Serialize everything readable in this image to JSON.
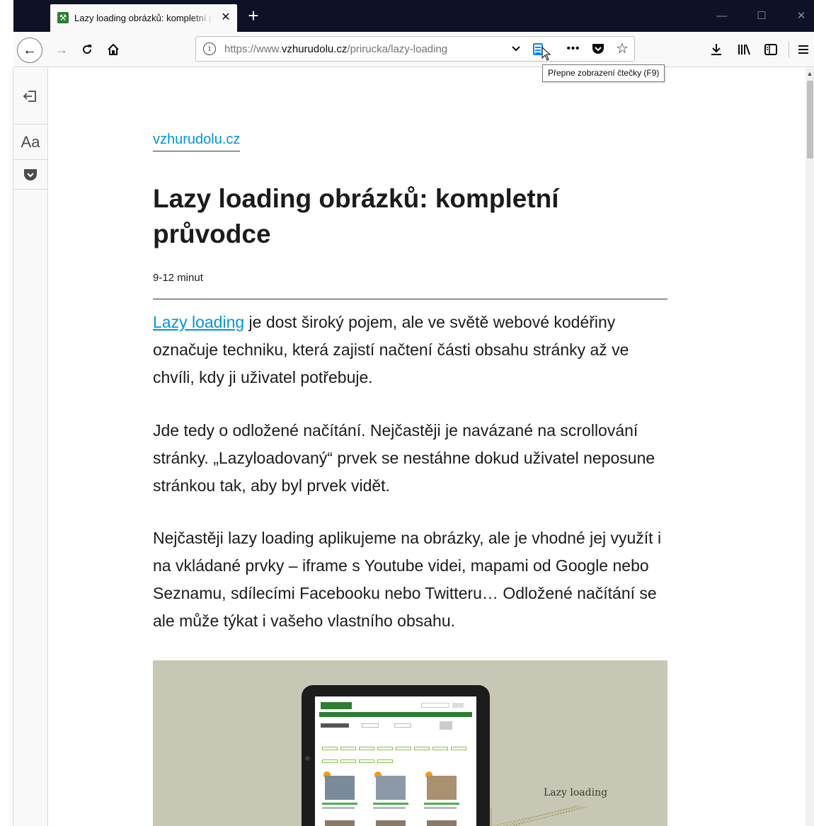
{
  "browser": {
    "tab": {
      "title": "Lazy loading obrázků: kompletní průvodce",
      "close_glyph": "✕"
    },
    "new_tab_glyph": "+",
    "window_controls": {
      "minimize": "—",
      "maximize": "☐",
      "close": "✕"
    },
    "nav": {
      "back": "←",
      "forward": "→",
      "reload": "C",
      "home": "⌂"
    },
    "url": {
      "prefix": "https://www.",
      "domain": "vzhurudolu.cz",
      "path": "/prirucka/lazy-loading"
    },
    "url_actions": {
      "dropdown": "⌄",
      "more": "•••",
      "star": "☆"
    },
    "toolbar": {
      "download": "↓",
      "library": "|||\\",
      "sidebar": "◫",
      "menu": "≡"
    },
    "tooltip": "Přepne zobrazení čtečky (F9)"
  },
  "reader_toolbar": {
    "close_glyph": "⇐",
    "type_controls_label": "Aa"
  },
  "article": {
    "domain": "vzhurudolu.cz",
    "title": "Lazy loading obrázků: kompletní průvodce",
    "reading_time": "9-12 minut",
    "paragraphs": [
      {
        "link": "Lazy loading",
        "text": " je dost široký pojem, ale ve světě webové kodéřiny označuje techniku, která zajistí načtení části obsahu stránky až ve chvíli, kdy ji uživatel potřebuje."
      },
      {
        "text": "Jde tedy o odložené načítání. Nejčastěji je navázané na scrollování stránky. „Lazyloadovaný“ prvek se nestáhne dokud uživatel neposune stránkou tak, aby byl prvek vidět."
      },
      {
        "text": "Nejčastěji lazy loading aplikujeme na obrázky, ale je vhodné jej využít i na vkládané prvky – iframe s Youtube videi, mapami od Google nebo Seznamu, sdílecími Facebooku nebo Twitteru… Odložené načítání se ale může týkat i vašeho vlastního obsahu."
      }
    ],
    "figure": {
      "label": "Lazy loading"
    }
  },
  "colors": {
    "titlebar": "#0f1126",
    "link": "#0095dd",
    "reader_icon": "#0a84ff",
    "text": "#1b1b1b"
  }
}
